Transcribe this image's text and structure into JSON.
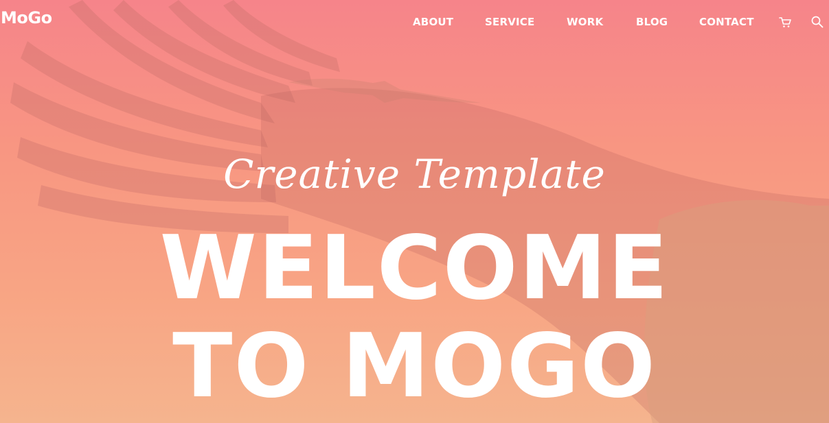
{
  "brand": {
    "logo": "MoGo"
  },
  "nav": {
    "items": [
      {
        "label": "ABOUT"
      },
      {
        "label": "SERVICE"
      },
      {
        "label": "WORK"
      },
      {
        "label": "BLOG"
      },
      {
        "label": "CONTACT"
      }
    ],
    "icons": [
      "cart-icon",
      "search-icon"
    ]
  },
  "hero": {
    "tagline": "Creative Template",
    "headline_line1": "WELCOME",
    "headline_line2": "TO MOGO",
    "background_image": "eagle in flight",
    "gradient_colors": [
      "#f6848a",
      "#f8a584",
      "#f5b48e"
    ]
  }
}
